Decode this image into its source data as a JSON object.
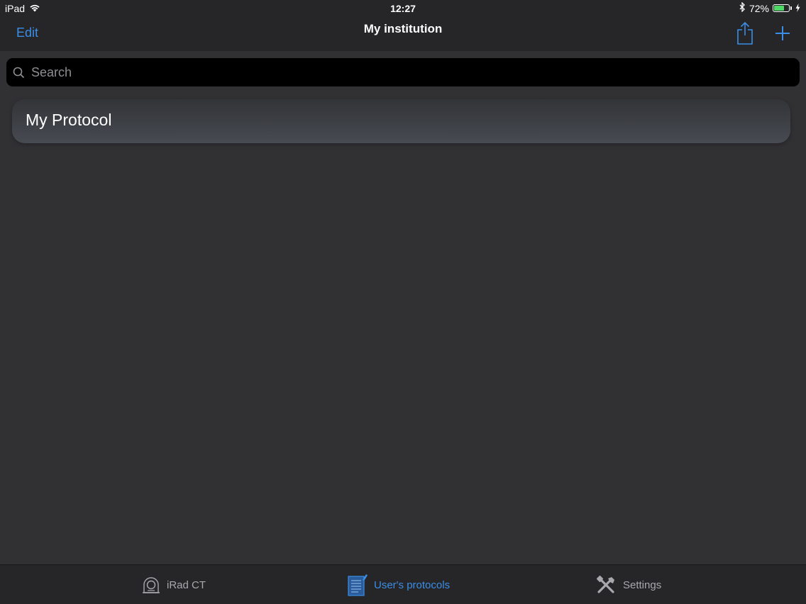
{
  "status_bar": {
    "device": "iPad",
    "time": "12:27",
    "battery_percent_label": "72%",
    "battery_level": 0.72,
    "icons": [
      "wifi-icon",
      "bluetooth-icon",
      "battery-icon",
      "charging-icon"
    ]
  },
  "nav": {
    "edit_label": "Edit",
    "title": "My institution",
    "icons": [
      "share-icon",
      "add-icon"
    ]
  },
  "search": {
    "placeholder": "Search",
    "value": ""
  },
  "protocols": {
    "items": [
      {
        "label": "My Protocol"
      }
    ]
  },
  "tab_bar": {
    "tabs": [
      {
        "label": "iRad CT",
        "icon": "scanner-icon",
        "selected": false
      },
      {
        "label": "User's protocols",
        "icon": "document-icon",
        "selected": true
      },
      {
        "label": "Settings",
        "icon": "tools-icon",
        "selected": false
      }
    ]
  },
  "colors": {
    "accent": "#3a8ee6",
    "background": "#313033",
    "bar_background": "#262628",
    "battery": "#4cd964",
    "inactive_tab": "#a8a8ad"
  }
}
